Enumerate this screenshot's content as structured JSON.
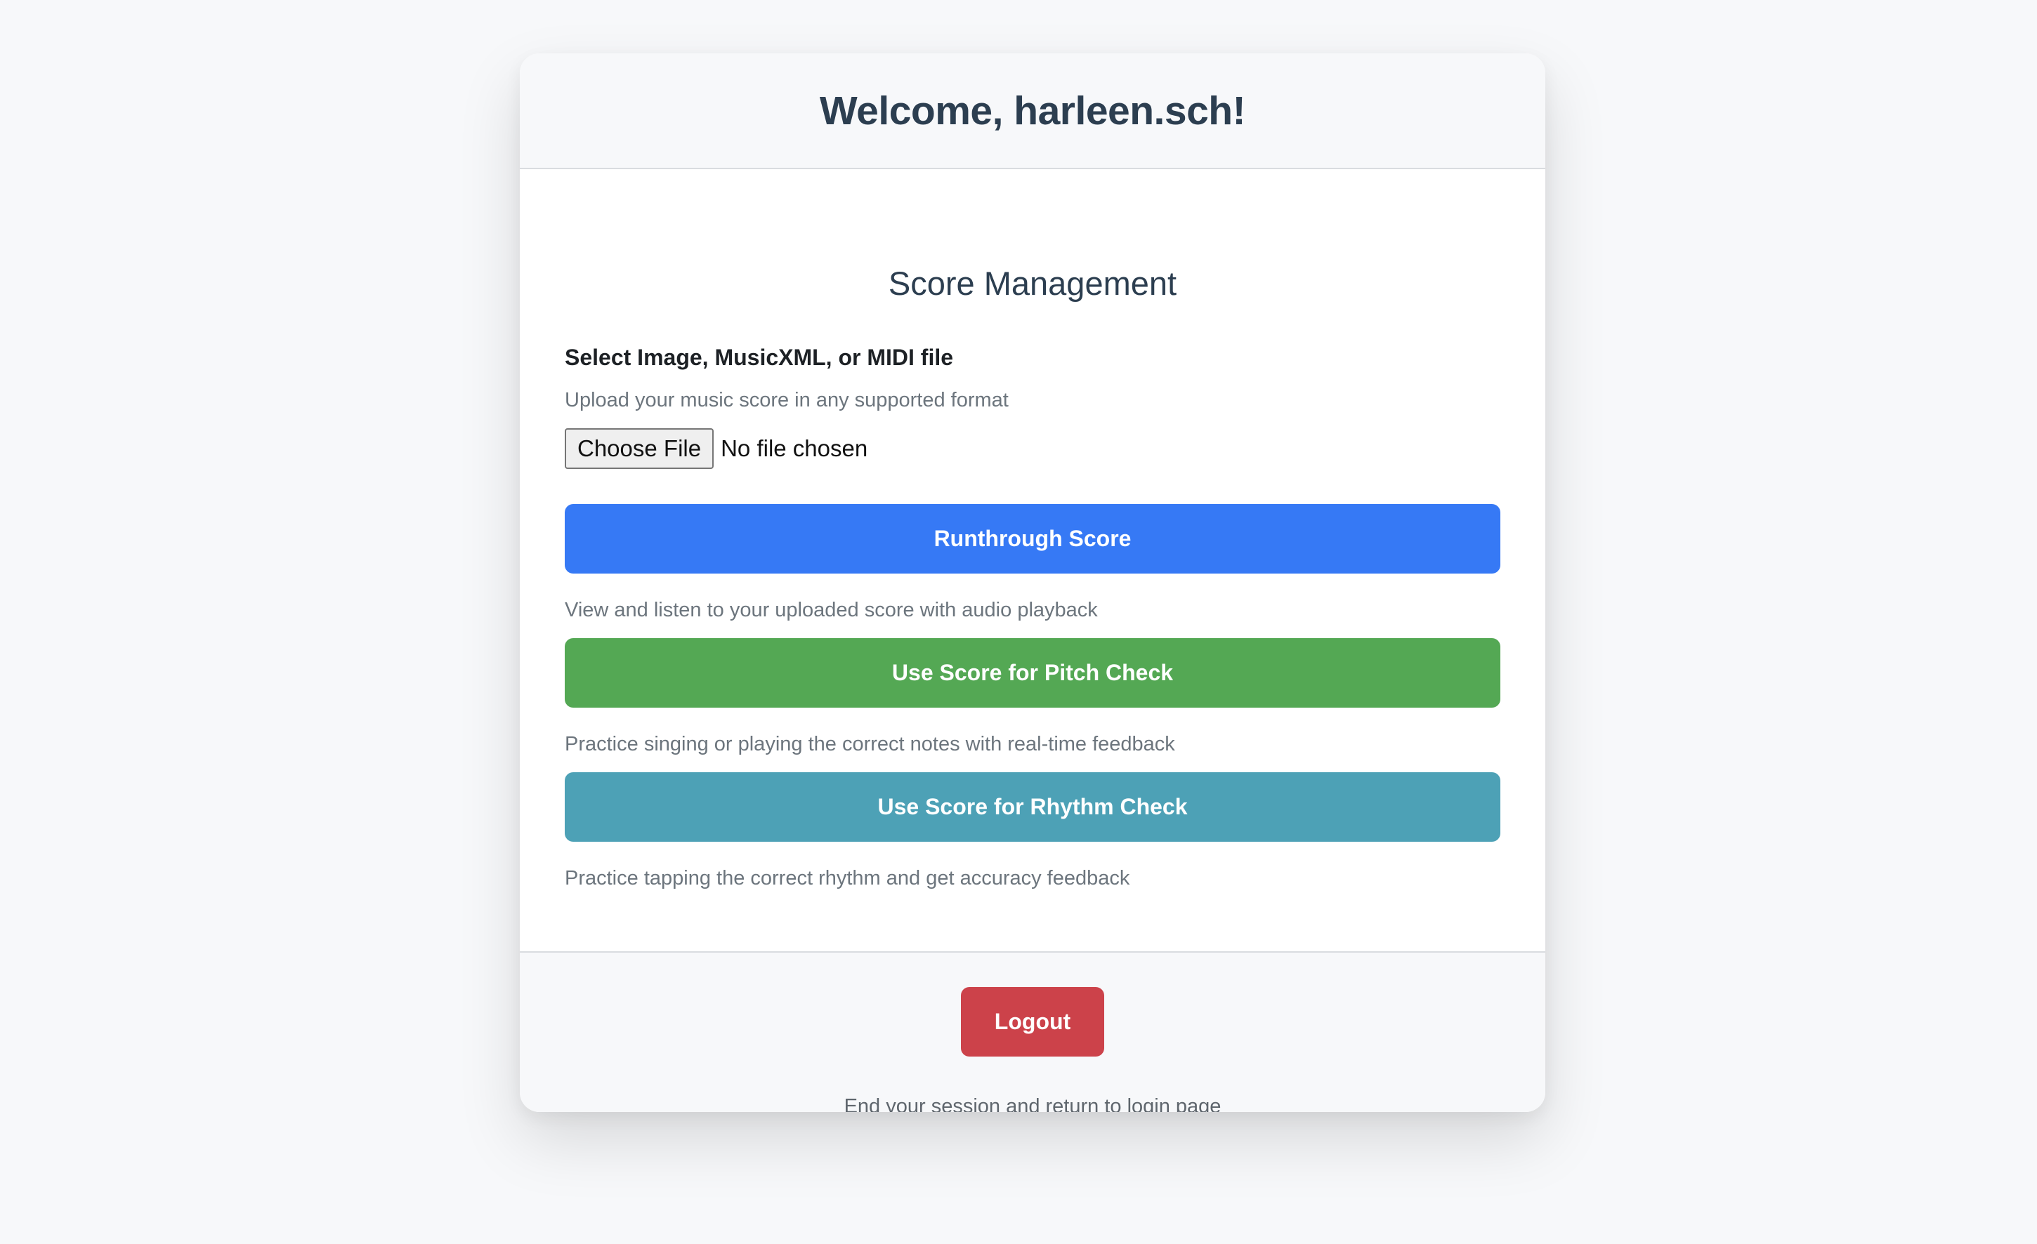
{
  "header": {
    "title": "Welcome, harleen.sch!"
  },
  "score_management": {
    "title": "Score Management",
    "file_label": "Select Image, MusicXML, or MIDI file",
    "file_hint": "Upload your music score in any supported format",
    "choose_file_label": "Choose File",
    "file_status": "No file chosen",
    "runthrough_label": "Runthrough Score",
    "runthrough_hint": "View and listen to your uploaded score with audio playback",
    "pitch_label": "Use Score for Pitch Check",
    "pitch_hint": "Practice singing or playing the correct notes with real-time feedback",
    "rhythm_label": "Use Score for Rhythm Check",
    "rhythm_hint": "Practice tapping the correct rhythm and get accuracy feedback"
  },
  "footer": {
    "logout_label": "Logout",
    "logout_hint": "End your session and return to login page"
  },
  "colors": {
    "runthrough": "#3679f5",
    "pitch": "#54a854",
    "rhythm": "#4da1b6",
    "logout": "#cc424a"
  }
}
